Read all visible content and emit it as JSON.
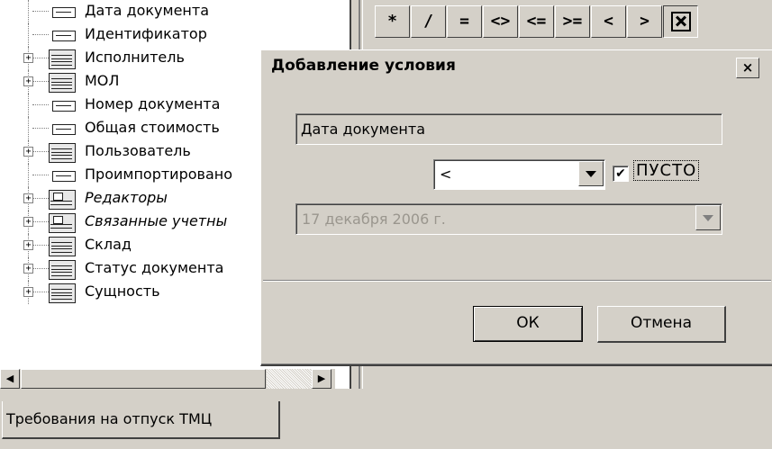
{
  "tree": {
    "items": [
      {
        "label": "Дата документа",
        "icon": "field-icon",
        "expandable": false,
        "italic": false,
        "selected": false
      },
      {
        "label": "Идентификатор",
        "icon": "field-icon",
        "expandable": false,
        "italic": false,
        "selected": false
      },
      {
        "label": "Исполнитель",
        "icon": "table-icon",
        "expandable": true,
        "italic": false,
        "selected": false
      },
      {
        "label": "МОЛ",
        "icon": "table-icon",
        "expandable": true,
        "italic": false,
        "selected": false
      },
      {
        "label": "Номер документа",
        "icon": "field-icon",
        "expandable": false,
        "italic": false,
        "selected": false
      },
      {
        "label": "Общая стоимость",
        "icon": "field-icon",
        "expandable": false,
        "italic": false,
        "selected": false
      },
      {
        "label": "Пользователь",
        "icon": "table-icon",
        "expandable": true,
        "italic": false,
        "selected": false
      },
      {
        "label": "Проимпортировано",
        "icon": "field-icon",
        "expandable": false,
        "italic": false,
        "selected": false
      },
      {
        "label": "Редакторы",
        "icon": "multi-table-icon",
        "expandable": true,
        "italic": true,
        "selected": false
      },
      {
        "label": "Связанные учетны",
        "icon": "multi-table-icon",
        "expandable": true,
        "italic": true,
        "selected": false
      },
      {
        "label": "Склад",
        "icon": "table-icon",
        "expandable": true,
        "italic": false,
        "selected": false
      },
      {
        "label": "Статус документа",
        "icon": "table-icon",
        "expandable": true,
        "italic": false,
        "selected": false
      },
      {
        "label": "Сущность",
        "icon": "table-icon",
        "expandable": true,
        "italic": false,
        "selected": false
      }
    ],
    "expand_glyph": "+"
  },
  "tabs": {
    "main_label": "Требования на отпуск ТМЦ"
  },
  "toolbar": {
    "operators": [
      "*",
      "/",
      "=",
      "<>",
      "<=",
      ">=",
      "<",
      ">"
    ],
    "close_icon": "close-box-icon"
  },
  "dialog": {
    "title": "Добавление условия",
    "close_glyph": "×",
    "field_name": "Дата документа",
    "operator_value": "<",
    "empty_checked": true,
    "check_glyph": "✔",
    "empty_label": "ПУСТО",
    "date_value": "17 декабря  2006 г.",
    "ok_label": "ОК",
    "cancel_label": "Отмена"
  },
  "colors": {
    "face": "#d4d0c8",
    "shadow": "#404040",
    "disabled_text": "#9a968e"
  }
}
